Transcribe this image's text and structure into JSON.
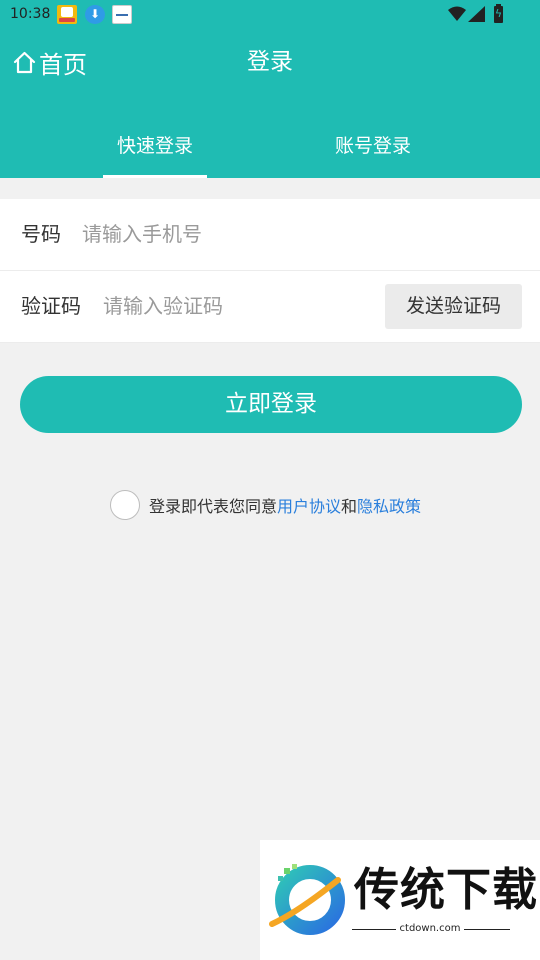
{
  "statusbar": {
    "time": "10:38",
    "notification_icons": [
      "game-app-icon",
      "download-icon",
      "news-app-icon"
    ],
    "system_icons": [
      "wifi-icon",
      "signal-icon",
      "battery-charging-icon"
    ]
  },
  "header": {
    "home_label": "首页",
    "home_icon": "home-icon",
    "title": "登录",
    "background_color": "#1fbcb3"
  },
  "tabs": [
    {
      "label": "快速登录",
      "active": true
    },
    {
      "label": "账号登录",
      "active": false
    }
  ],
  "form": {
    "phone_label": "号码",
    "phone_placeholder": "请输入手机号",
    "phone_value": "",
    "code_label": "验证码",
    "code_placeholder": "请输入验证码",
    "code_value": "",
    "send_code_label": "发送验证码"
  },
  "login_button_label": "立即登录",
  "agreement": {
    "checked": false,
    "prefix": "登录即代表您同意",
    "user_agreement": "用户协议",
    "conjunction": "和",
    "privacy_policy": "隐私政策",
    "link_color": "#2a7fdc"
  },
  "watermark": {
    "brand": "传统下载",
    "url": "ctdown.com"
  }
}
